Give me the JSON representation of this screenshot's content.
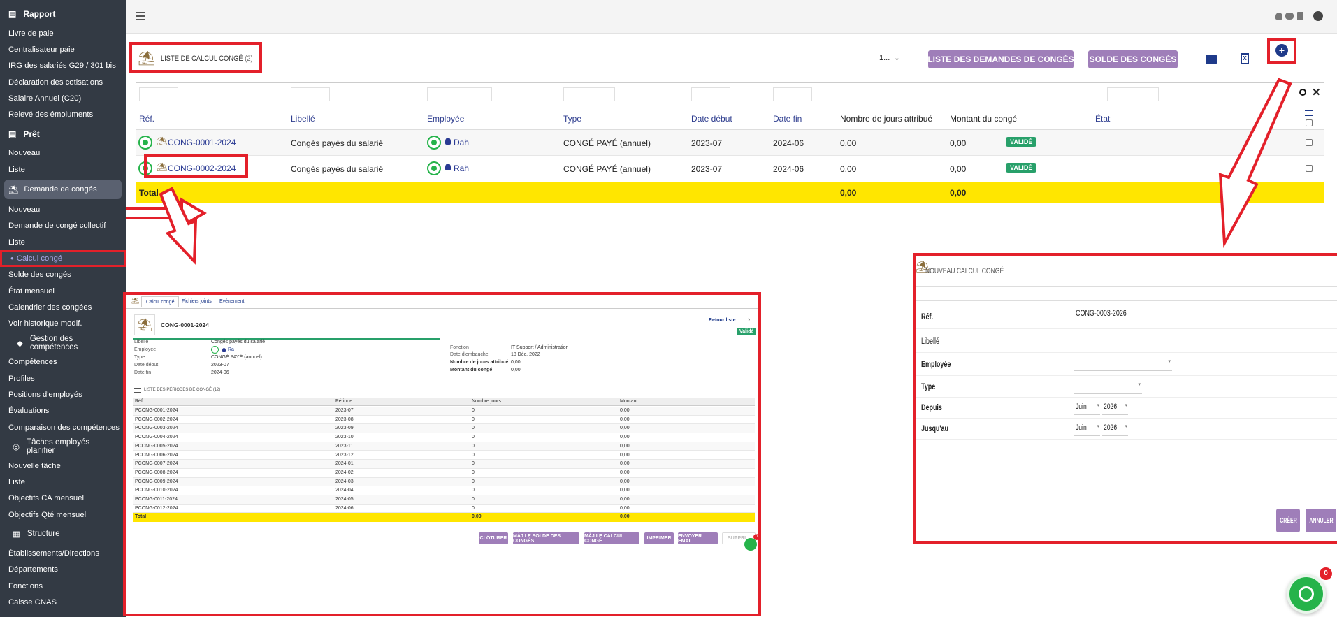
{
  "sidebar": {
    "sec_rapport": "Rapport",
    "rapport_items": [
      "Livre de paie",
      "Centralisateur paie",
      "IRG des salariés G29 / 301 bis",
      "Déclaration des cotisations",
      "Salaire Annuel (C20)",
      "Relevé des émoluments"
    ],
    "sec_pret": "Prêt",
    "pret_items": [
      "Nouveau",
      "Liste"
    ],
    "sec_conges": "Demande de congés",
    "conges_items": [
      "Nouveau",
      "Demande de congé collectif",
      "Liste"
    ],
    "calc_conge": "Calcul congé",
    "conges_items2": [
      "Solde des congés",
      "État mensuel",
      "Calendrier des congées",
      "Voir historique modif."
    ],
    "sec_competences": "Gestion des compétences",
    "comp_items": [
      "Compétences",
      "Profiles",
      "Positions d'employés",
      "Évaluations",
      "Comparaison des compétences"
    ],
    "sec_taches": "Tâches employés planifier",
    "taches_items": [
      "Nouvelle tâche",
      "Liste",
      "Objectifs CA mensuel",
      "Objectifs Qté mensuel"
    ],
    "sec_structure": "Structure",
    "structure_items": [
      "Établissements/Directions",
      "Départements",
      "Fonctions",
      "Caisse CNAS"
    ]
  },
  "header": {
    "title": "LISTE DE CALCUL CONGÉ",
    "count": "(2)",
    "page_select": "1...",
    "btn_liste_demandes": "LISTE DES DEMANDES DE CONGÉS",
    "btn_solde": "SOLDE DES CONGÉS"
  },
  "table": {
    "columns": [
      "Réf.",
      "Libellé",
      "Employée",
      "Type",
      "Date début",
      "Date fin",
      "Nombre de jours attribué",
      "Montant du congé",
      "État"
    ],
    "rows": [
      {
        "ref": "CONG-0001-2024",
        "libelle": "Congés payés du salarié",
        "employe": "Dah",
        "type": "CONGÉ PAYÉ (annuel)",
        "debut": "2023-07",
        "fin": "2024-06",
        "jours": "0,00",
        "montant": "0,00",
        "etat": "VALIDÉ"
      },
      {
        "ref": "CONG-0002-2024",
        "libelle": "Congés payés du salarié",
        "employe": "Rah",
        "type": "CONGÉ PAYÉ (annuel)",
        "debut": "2023-07",
        "fin": "2024-06",
        "jours": "0,00",
        "montant": "0,00",
        "etat": "VALIDÉ"
      }
    ],
    "total_label": "Total",
    "total_jours": "0,00",
    "total_montant": "0,00"
  },
  "detail": {
    "tabs": [
      "Calcul congé",
      "Fichiers joints",
      "Evénement"
    ],
    "ref": "CONG-0001-2024",
    "retour": "Retour liste",
    "status": "Validé",
    "left_labels": [
      "Libellé",
      "Employée",
      "Type",
      "Date début",
      "Date fin"
    ],
    "left_values": [
      "Congés payés du salarié",
      "Ra",
      "CONGÉ PAYÉ (annuel)",
      "2023-07",
      "2024-06"
    ],
    "right_labels": [
      "Fonction",
      "Date d'embauche",
      "Nombre de jours attribué",
      "Montant du congé"
    ],
    "right_values": [
      "IT Support / Administration",
      "18 Déc. 2022",
      "0,00",
      "0,00"
    ],
    "periods_title": "LISTE DES PÉRIODES DE CONGÉ (12)",
    "period_cols": [
      "Réf.",
      "Période",
      "Nombre jours",
      "Montant"
    ],
    "periods": [
      [
        "PCONG-0001-2024",
        "2023-07",
        "0",
        "0,00"
      ],
      [
        "PCONG-0002-2024",
        "2023-08",
        "0",
        "0,00"
      ],
      [
        "PCONG-0003-2024",
        "2023-09",
        "0",
        "0,00"
      ],
      [
        "PCONG-0004-2024",
        "2023-10",
        "0",
        "0,00"
      ],
      [
        "PCONG-0005-2024",
        "2023-11",
        "0",
        "0,00"
      ],
      [
        "PCONG-0006-2024",
        "2023-12",
        "0",
        "0,00"
      ],
      [
        "PCONG-0007-2024",
        "2024-01",
        "0",
        "0,00"
      ],
      [
        "PCONG-0008-2024",
        "2024-02",
        "0",
        "0,00"
      ],
      [
        "PCONG-0009-2024",
        "2024-03",
        "0",
        "0,00"
      ],
      [
        "PCONG-0010-2024",
        "2024-04",
        "0",
        "0,00"
      ],
      [
        "PCONG-0011-2024",
        "2024-05",
        "0",
        "0,00"
      ],
      [
        "PCONG-0012-2024",
        "2024-06",
        "0",
        "0,00"
      ]
    ],
    "total_label": "Total",
    "total_jours": "0,00",
    "total_montant": "0,00",
    "buttons": [
      "CLÔTURER",
      "MÀJ LE SOLDE DES CONGÉS",
      "MÀJ LE CALCUL CONGÉ",
      "IMPRIMER",
      "ENVOYER EMAIL",
      "SUPPRI..."
    ],
    "wa_badge": "0"
  },
  "form": {
    "title": "NOUVEAU CALCUL CONGÉ",
    "labels": [
      "Réf.",
      "Libellé",
      "Employée",
      "Type",
      "Depuis",
      "Jusqu'au"
    ],
    "ref_value": "CONG-0003-2026",
    "month": "Juin",
    "year": "2026",
    "btn_create": "CRÉER",
    "btn_cancel": "ANNULER"
  },
  "wa_float_badge": "0",
  "colors": {
    "sidebar": "#333a44",
    "accent": "#9f7eb9",
    "red": "#e3202a",
    "total": "#ffe600",
    "valid": "#28a06a"
  }
}
